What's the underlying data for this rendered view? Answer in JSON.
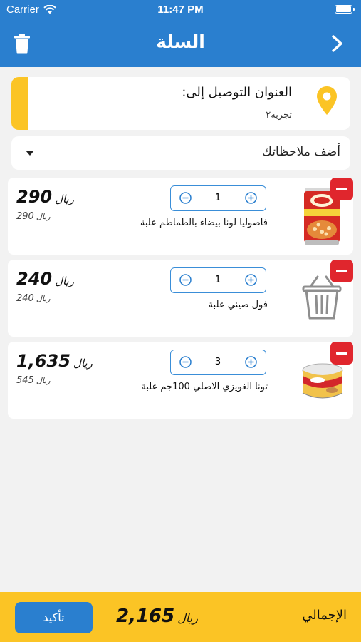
{
  "status_bar": {
    "carrier": "Carrier",
    "time": "11:47 PM"
  },
  "nav": {
    "title": "السلة"
  },
  "address": {
    "label": "العنوان التوصيل إلى:",
    "value": "تجربه٢"
  },
  "notes": {
    "label": "أضف ملاحظاتك"
  },
  "items": [
    {
      "name": "فاصوليا لونا بيضاء بالطماطم علبة",
      "quantity": "1",
      "total": "290",
      "unit_price": "290",
      "currency": "ريال",
      "image": "canned-beans-image"
    },
    {
      "name": "فول صيني علبة",
      "quantity": "1",
      "total": "240",
      "unit_price": "240",
      "currency": "ريال",
      "image": "basket-placeholder-icon"
    },
    {
      "name": "تونا الغويزي الاصلي 100جم علبة",
      "quantity": "3",
      "total": "1,635",
      "unit_price": "545",
      "currency": "ريال",
      "image": "tuna-can-image"
    }
  ],
  "footer": {
    "total_label": "الإجمالي",
    "total": "2,165",
    "currency": "ريال",
    "confirm_label": "تأكيد"
  },
  "colors": {
    "primary": "#2a7fcf",
    "accent": "#fbc425",
    "danger": "#e0262d"
  }
}
